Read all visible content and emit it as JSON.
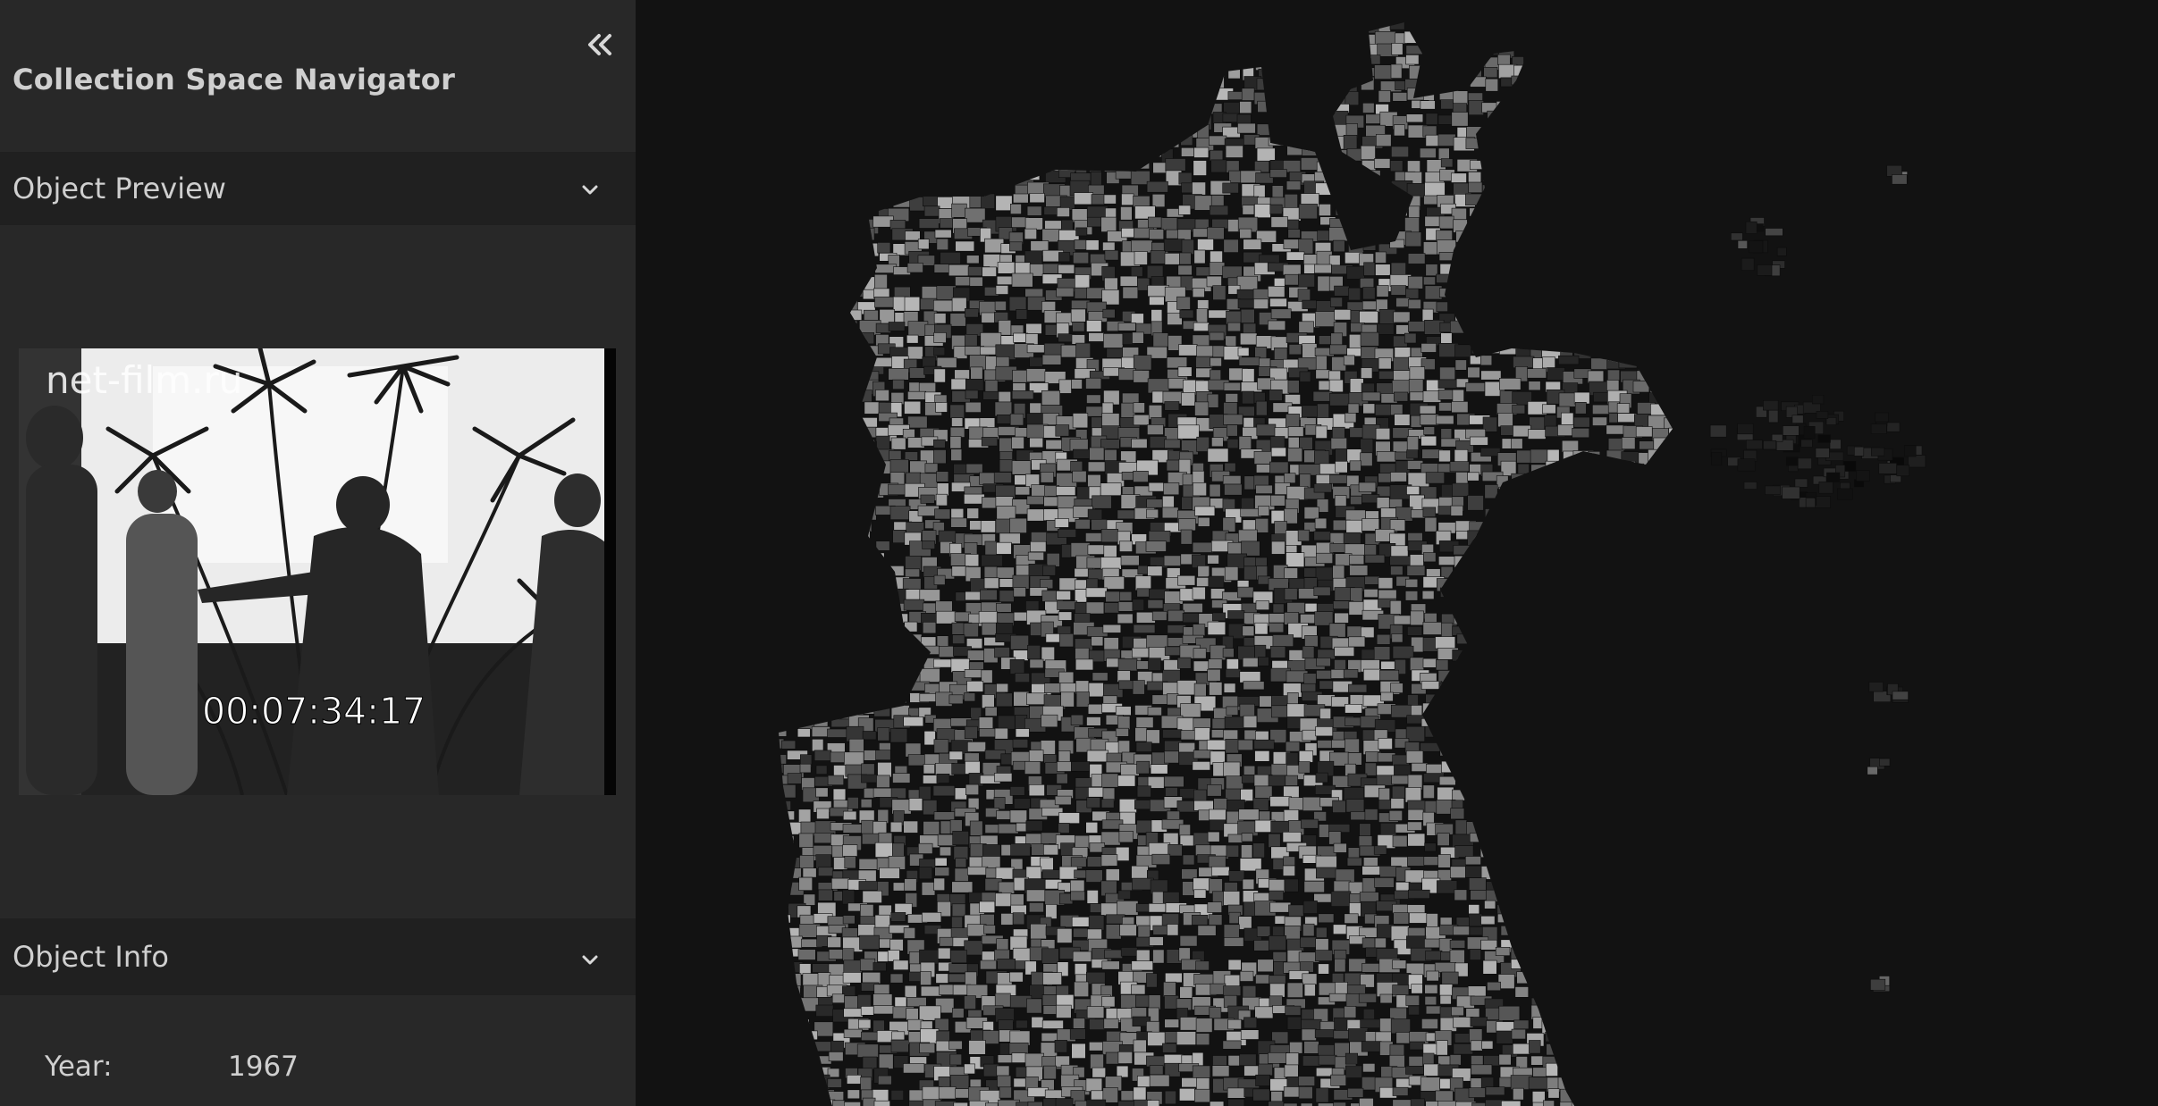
{
  "sidebar": {
    "title": "Collection Space Navigator",
    "collapse_icon": "double-chevron-left-icon",
    "preview_section": {
      "title": "Object Preview",
      "watermark": "net-film.ru",
      "timecode": "00:07:34:17"
    },
    "info_section": {
      "title": "Object Info",
      "fields": [
        {
          "label": "Year:",
          "value": "1967"
        }
      ]
    }
  },
  "colors": {
    "sidebar_bg": "#282828",
    "section_header_bg": "#202020",
    "canvas_bg": "#121212",
    "text": "#cfcfcf"
  }
}
